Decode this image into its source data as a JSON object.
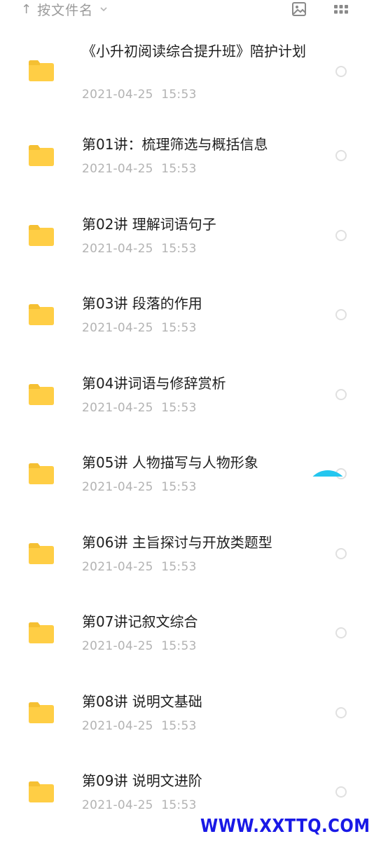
{
  "toolbar": {
    "sort_arrow": "↑",
    "sort_label": "按文件名",
    "sort_chevron_icon": "chevron-down-icon",
    "image_icon": "image-icon",
    "grid_icon": "grid-icon"
  },
  "colors": {
    "folder": "#FFCE45",
    "folder_tab": "#F5C033",
    "accent": "#24C6EF",
    "watermark": "#1919E6"
  },
  "files": [
    {
      "name": "《小升初阅读综合提升班》陪护计划",
      "date": "2021-04-25  15:53"
    },
    {
      "name": "第01讲：梳理筛选与概括信息",
      "date": "2021-04-25  15:53"
    },
    {
      "name": "第02讲 理解词语句子",
      "date": "2021-04-25  15:53"
    },
    {
      "name": "第03讲 段落的作用",
      "date": "2021-04-25  15:53"
    },
    {
      "name": "第04讲词语与修辞赏析",
      "date": "2021-04-25  15:53"
    },
    {
      "name": "第05讲 人物描写与人物形象",
      "date": "2021-04-25  15:53"
    },
    {
      "name": "第06讲 主旨探讨与开放类题型",
      "date": "2021-04-25  15:53"
    },
    {
      "name": "第07讲记叙文综合",
      "date": "2021-04-25  15:53"
    },
    {
      "name": "第08讲 说明文基础",
      "date": "2021-04-25  15:53"
    },
    {
      "name": "第09讲 说明文进阶",
      "date": "2021-04-25  15:53"
    }
  ],
  "watermark": "WWW.XXTTQ.COM"
}
